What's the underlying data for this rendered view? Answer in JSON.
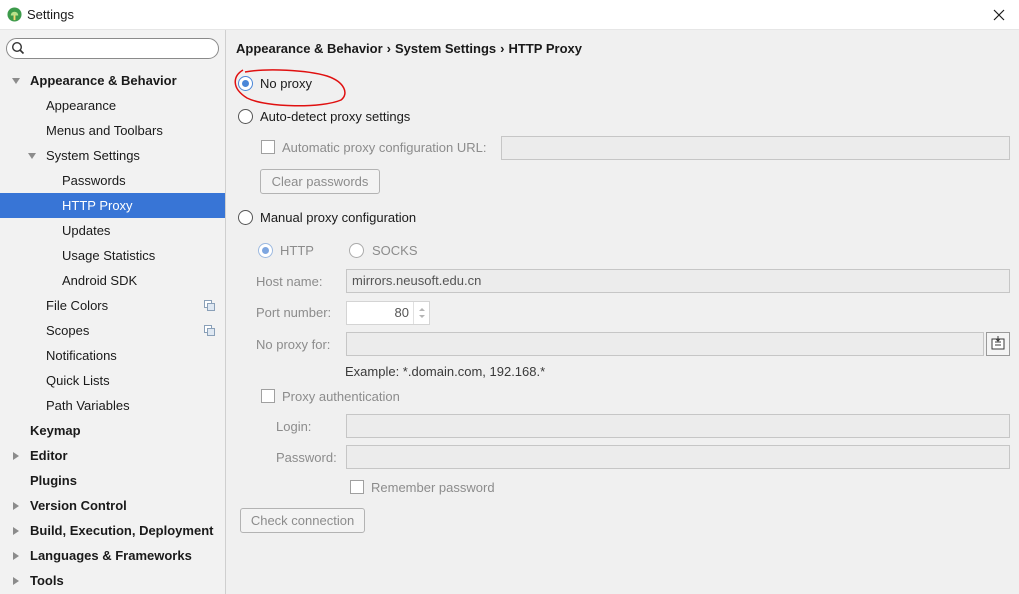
{
  "window": {
    "title": "Settings"
  },
  "sidebar": {
    "search": {
      "value": "",
      "placeholder": ""
    },
    "items": [
      {
        "label": "Appearance & Behavior"
      },
      {
        "label": "Appearance"
      },
      {
        "label": "Menus and Toolbars"
      },
      {
        "label": "System Settings"
      },
      {
        "label": "Passwords"
      },
      {
        "label": "HTTP Proxy"
      },
      {
        "label": "Updates"
      },
      {
        "label": "Usage Statistics"
      },
      {
        "label": "Android SDK"
      },
      {
        "label": "File Colors"
      },
      {
        "label": "Scopes"
      },
      {
        "label": "Notifications"
      },
      {
        "label": "Quick Lists"
      },
      {
        "label": "Path Variables"
      },
      {
        "label": "Keymap"
      },
      {
        "label": "Editor"
      },
      {
        "label": "Plugins"
      },
      {
        "label": "Version Control"
      },
      {
        "label": "Build, Execution, Deployment"
      },
      {
        "label": "Languages & Frameworks"
      },
      {
        "label": "Tools"
      }
    ]
  },
  "breadcrumb": {
    "part1": "Appearance & Behavior",
    "part2": "System Settings",
    "part3": "HTTP Proxy",
    "separator": "›"
  },
  "proxy": {
    "no_proxy": "No proxy",
    "auto_detect": "Auto-detect proxy settings",
    "auto_config_url_label": "Automatic proxy configuration URL:",
    "auto_config_url_value": "",
    "clear_passwords": "Clear passwords",
    "manual": "Manual proxy configuration",
    "http": "HTTP",
    "socks": "SOCKS",
    "host_label": "Host name:",
    "host_value": "mirrors.neusoft.edu.cn",
    "port_label": "Port number:",
    "port_value": "80",
    "no_proxy_for_label": "No proxy for:",
    "no_proxy_for_value": "",
    "example": "Example: *.domain.com, 192.168.*",
    "proxy_auth": "Proxy authentication",
    "login_label": "Login:",
    "login_value": "",
    "password_label": "Password:",
    "password_value": "",
    "remember_password": "Remember password",
    "check_connection": "Check connection"
  },
  "colors": {
    "selection": "#3875d6",
    "radio_accent": "#4a86d8",
    "annotation": "#e01010"
  }
}
